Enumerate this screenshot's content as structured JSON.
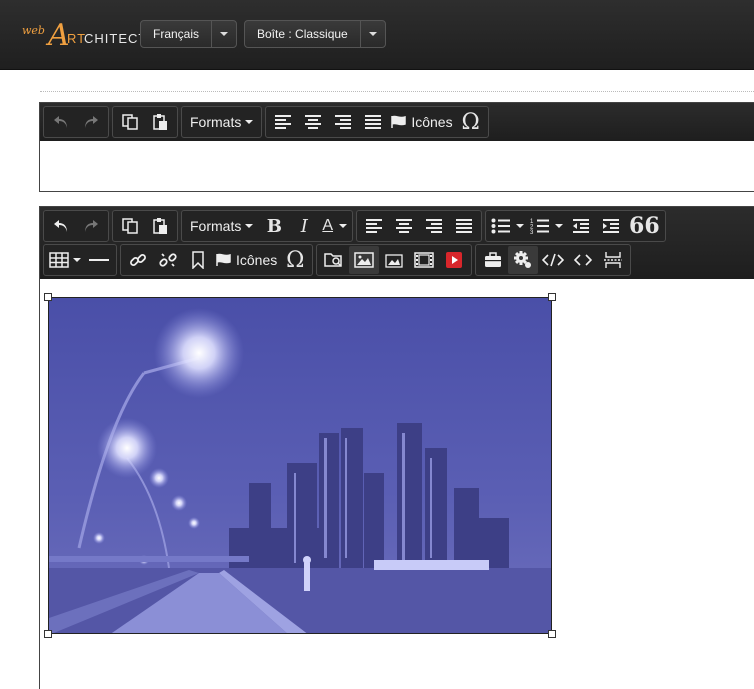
{
  "logo": {
    "web": "web",
    "initial": "A",
    "rt": "RT",
    "rest": "CHITECTE"
  },
  "header": {
    "language": {
      "label": "Français"
    },
    "box": {
      "label": "Boîte : Classique"
    }
  },
  "toolbar_small": {
    "formats_label": "Formats",
    "icons_label": "Icônes",
    "omega": "Ω"
  },
  "toolbar_full": {
    "formats_label": "Formats",
    "bold": "B",
    "italic": "I",
    "font_color": "A",
    "quote": "66",
    "icons_label": "Icônes",
    "omega": "Ω"
  },
  "colors": {
    "toolbar_bg": "#1e1e1e",
    "logo_accent": "#f0a040",
    "image_tint": "#5a5cae"
  }
}
